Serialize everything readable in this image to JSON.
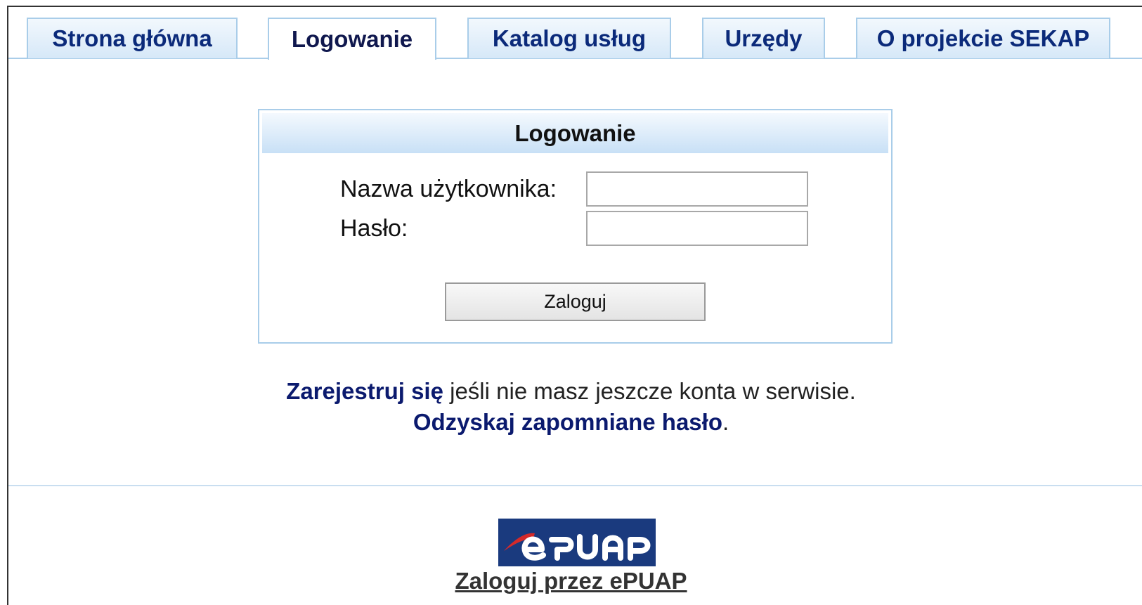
{
  "tabs": [
    {
      "label": "Strona główna"
    },
    {
      "label": "Logowanie"
    },
    {
      "label": "Katalog usług"
    },
    {
      "label": "Urzędy"
    },
    {
      "label": "O projekcie SEKAP"
    }
  ],
  "login": {
    "title": "Logowanie",
    "username_label": "Nazwa użytkownika:",
    "username_value": "",
    "password_label": "Hasło:",
    "password_value": "",
    "submit_label": "Zaloguj"
  },
  "info": {
    "register_link": "Zarejestruj się",
    "register_text": " jeśli nie masz jeszcze konta w serwisie.",
    "recover_link": "Odzyskaj zapomniane hasło",
    "recover_suffix": "."
  },
  "epuap": {
    "logo_text": "ePUAP",
    "link": "Zaloguj przez ePUAP"
  },
  "colors": {
    "tab_text": "#0b2a7a",
    "border": "#a9cde9",
    "link": "#0b1a6e",
    "epuap_blue": "#1a3a7e",
    "epuap_red": "#d42a2a"
  }
}
